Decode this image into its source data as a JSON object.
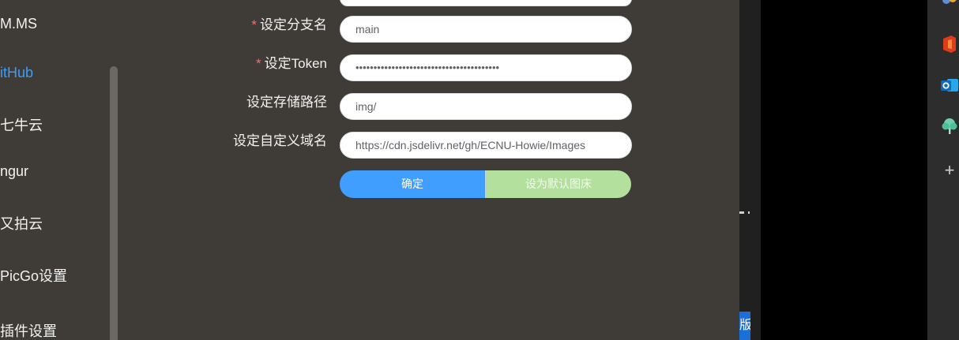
{
  "sidebar": {
    "items": [
      {
        "label": "M.MS"
      },
      {
        "label": "itHub"
      },
      {
        "label": "七牛云"
      },
      {
        "label": "ngur"
      },
      {
        "label": "又拍云"
      },
      {
        "label": "PicGo设置"
      },
      {
        "label": "插件设置"
      }
    ],
    "active_index": 1
  },
  "form": {
    "branch": {
      "label": "设定分支名",
      "required_mark": "*",
      "value": "main"
    },
    "token": {
      "label": "设定Token",
      "required_mark": "*",
      "value": "••••••••••••••••••••••••••••••••••••••••"
    },
    "path": {
      "label": "设定存储路径",
      "value": "img/"
    },
    "domain": {
      "label": "设定自定义域名",
      "value": "https://cdn.jsdelivr.net/gh/ECNU-Howie/Images"
    }
  },
  "buttons": {
    "confirm": "确定",
    "set_default": "设为默认图床"
  },
  "background_fragment": "版",
  "taskbar": {
    "icons": [
      "people-icon",
      "office-icon",
      "outlook-icon",
      "tree-icon",
      "plus-icon"
    ]
  },
  "colors": {
    "accent": "#409eff",
    "default_button": "#b3e19d",
    "required": "#f56c6c",
    "active_sidebar": "#3d9df5",
    "panel_bg": "#3f3c37"
  }
}
